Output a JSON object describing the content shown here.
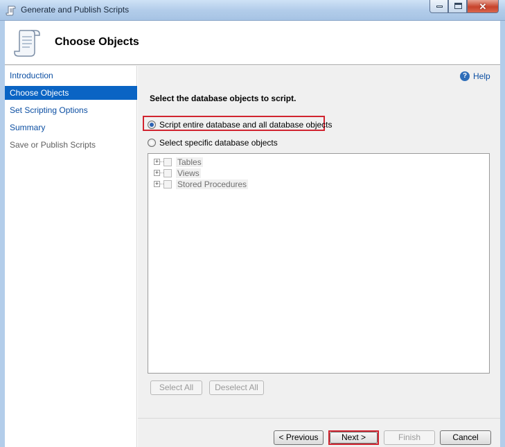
{
  "window": {
    "title": "Generate and Publish Scripts",
    "icon": "scroll-icon"
  },
  "header": {
    "title": "Choose Objects",
    "icon": "scroll-icon"
  },
  "nav": {
    "items": [
      {
        "label": "Introduction"
      },
      {
        "label": "Choose Objects"
      },
      {
        "label": "Set Scripting Options"
      },
      {
        "label": "Summary"
      },
      {
        "label": "Save or Publish Scripts"
      }
    ]
  },
  "main": {
    "help_label": "Help",
    "section_title": "Select the database objects to script.",
    "radio_entire": "Script entire database and all database objects",
    "radio_specific": "Select specific database objects",
    "tree_items": [
      {
        "label": "Tables"
      },
      {
        "label": "Views"
      },
      {
        "label": "Stored Procedures"
      }
    ],
    "select_all": "Select All",
    "deselect_all": "Deselect All"
  },
  "footer": {
    "previous": "< Previous",
    "next": "Next >",
    "finish": "Finish",
    "cancel": "Cancel"
  },
  "colors": {
    "highlight": "#d1232f",
    "nav_active": "#0a64c4"
  }
}
